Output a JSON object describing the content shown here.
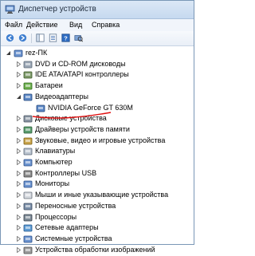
{
  "window": {
    "title": "Диспетчер устройств"
  },
  "menu": {
    "items": [
      "Файл",
      "Действие",
      "Вид",
      "Справка"
    ]
  },
  "tree": {
    "root": "rez-ПК",
    "items": [
      {
        "label": "DVD и CD-ROM дисководы",
        "icon": "dvd-drive-icon"
      },
      {
        "label": "IDE ATA/ATAPI контроллеры",
        "icon": "ide-controller-icon"
      },
      {
        "label": "Батареи",
        "icon": "battery-icon"
      },
      {
        "label": "Видеоадаптеры",
        "icon": "display-adapter-icon",
        "expanded": true
      },
      {
        "label": "NVIDIA GeForce GT 630M",
        "icon": "display-adapter-icon",
        "child": true
      },
      {
        "label": "Дисковые устройства",
        "icon": "disk-drive-icon"
      },
      {
        "label": "Драйверы устройств памяти",
        "icon": "memory-icon"
      },
      {
        "label": "Звуковые, видео и игровые устройства",
        "icon": "sound-icon"
      },
      {
        "label": "Клавиатуры",
        "icon": "keyboard-icon"
      },
      {
        "label": "Компьютер",
        "icon": "computer-icon"
      },
      {
        "label": "Контроллеры USB",
        "icon": "usb-icon"
      },
      {
        "label": "Мониторы",
        "icon": "monitor-icon"
      },
      {
        "label": "Мыши и иные указывающие устройства",
        "icon": "mouse-icon"
      },
      {
        "label": "Переносные устройства",
        "icon": "portable-device-icon"
      },
      {
        "label": "Процессоры",
        "icon": "processor-icon"
      },
      {
        "label": "Сетевые адаптеры",
        "icon": "network-adapter-icon"
      },
      {
        "label": "Системные устройства",
        "icon": "system-device-icon"
      },
      {
        "label": "Устройства обработки изображений",
        "icon": "imaging-device-icon"
      }
    ]
  },
  "colors": {
    "accent_underline": "#e01010",
    "titlebar": "#c6d9ef"
  }
}
